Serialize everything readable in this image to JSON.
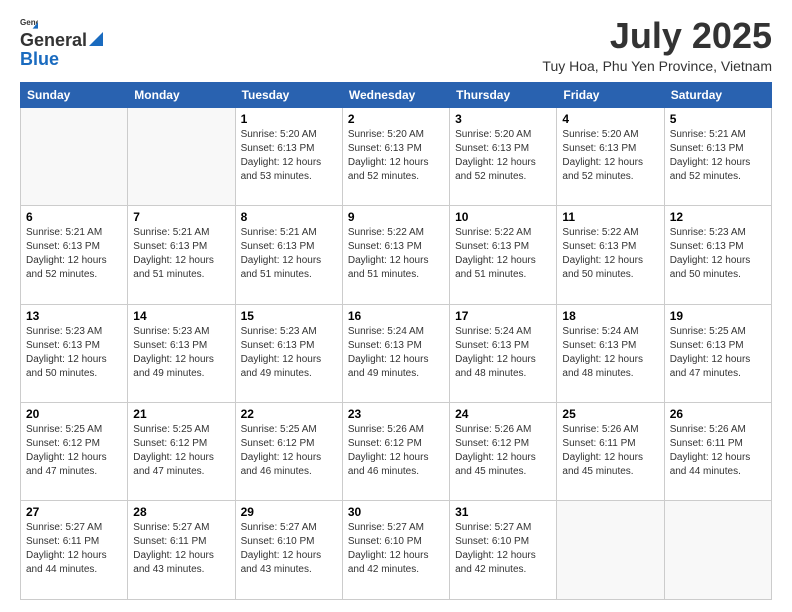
{
  "logo": {
    "line1": "General",
    "line2": "Blue"
  },
  "title": "July 2025",
  "subtitle": "Tuy Hoa, Phu Yen Province, Vietnam",
  "days_of_week": [
    "Sunday",
    "Monday",
    "Tuesday",
    "Wednesday",
    "Thursday",
    "Friday",
    "Saturday"
  ],
  "weeks": [
    [
      {
        "day": "",
        "sunrise": "",
        "sunset": "",
        "daylight": ""
      },
      {
        "day": "",
        "sunrise": "",
        "sunset": "",
        "daylight": ""
      },
      {
        "day": "1",
        "sunrise": "Sunrise: 5:20 AM",
        "sunset": "Sunset: 6:13 PM",
        "daylight": "Daylight: 12 hours and 53 minutes."
      },
      {
        "day": "2",
        "sunrise": "Sunrise: 5:20 AM",
        "sunset": "Sunset: 6:13 PM",
        "daylight": "Daylight: 12 hours and 52 minutes."
      },
      {
        "day": "3",
        "sunrise": "Sunrise: 5:20 AM",
        "sunset": "Sunset: 6:13 PM",
        "daylight": "Daylight: 12 hours and 52 minutes."
      },
      {
        "day": "4",
        "sunrise": "Sunrise: 5:20 AM",
        "sunset": "Sunset: 6:13 PM",
        "daylight": "Daylight: 12 hours and 52 minutes."
      },
      {
        "day": "5",
        "sunrise": "Sunrise: 5:21 AM",
        "sunset": "Sunset: 6:13 PM",
        "daylight": "Daylight: 12 hours and 52 minutes."
      }
    ],
    [
      {
        "day": "6",
        "sunrise": "Sunrise: 5:21 AM",
        "sunset": "Sunset: 6:13 PM",
        "daylight": "Daylight: 12 hours and 52 minutes."
      },
      {
        "day": "7",
        "sunrise": "Sunrise: 5:21 AM",
        "sunset": "Sunset: 6:13 PM",
        "daylight": "Daylight: 12 hours and 51 minutes."
      },
      {
        "day": "8",
        "sunrise": "Sunrise: 5:21 AM",
        "sunset": "Sunset: 6:13 PM",
        "daylight": "Daylight: 12 hours and 51 minutes."
      },
      {
        "day": "9",
        "sunrise": "Sunrise: 5:22 AM",
        "sunset": "Sunset: 6:13 PM",
        "daylight": "Daylight: 12 hours and 51 minutes."
      },
      {
        "day": "10",
        "sunrise": "Sunrise: 5:22 AM",
        "sunset": "Sunset: 6:13 PM",
        "daylight": "Daylight: 12 hours and 51 minutes."
      },
      {
        "day": "11",
        "sunrise": "Sunrise: 5:22 AM",
        "sunset": "Sunset: 6:13 PM",
        "daylight": "Daylight: 12 hours and 50 minutes."
      },
      {
        "day": "12",
        "sunrise": "Sunrise: 5:23 AM",
        "sunset": "Sunset: 6:13 PM",
        "daylight": "Daylight: 12 hours and 50 minutes."
      }
    ],
    [
      {
        "day": "13",
        "sunrise": "Sunrise: 5:23 AM",
        "sunset": "Sunset: 6:13 PM",
        "daylight": "Daylight: 12 hours and 50 minutes."
      },
      {
        "day": "14",
        "sunrise": "Sunrise: 5:23 AM",
        "sunset": "Sunset: 6:13 PM",
        "daylight": "Daylight: 12 hours and 49 minutes."
      },
      {
        "day": "15",
        "sunrise": "Sunrise: 5:23 AM",
        "sunset": "Sunset: 6:13 PM",
        "daylight": "Daylight: 12 hours and 49 minutes."
      },
      {
        "day": "16",
        "sunrise": "Sunrise: 5:24 AM",
        "sunset": "Sunset: 6:13 PM",
        "daylight": "Daylight: 12 hours and 49 minutes."
      },
      {
        "day": "17",
        "sunrise": "Sunrise: 5:24 AM",
        "sunset": "Sunset: 6:13 PM",
        "daylight": "Daylight: 12 hours and 48 minutes."
      },
      {
        "day": "18",
        "sunrise": "Sunrise: 5:24 AM",
        "sunset": "Sunset: 6:13 PM",
        "daylight": "Daylight: 12 hours and 48 minutes."
      },
      {
        "day": "19",
        "sunrise": "Sunrise: 5:25 AM",
        "sunset": "Sunset: 6:13 PM",
        "daylight": "Daylight: 12 hours and 47 minutes."
      }
    ],
    [
      {
        "day": "20",
        "sunrise": "Sunrise: 5:25 AM",
        "sunset": "Sunset: 6:12 PM",
        "daylight": "Daylight: 12 hours and 47 minutes."
      },
      {
        "day": "21",
        "sunrise": "Sunrise: 5:25 AM",
        "sunset": "Sunset: 6:12 PM",
        "daylight": "Daylight: 12 hours and 47 minutes."
      },
      {
        "day": "22",
        "sunrise": "Sunrise: 5:25 AM",
        "sunset": "Sunset: 6:12 PM",
        "daylight": "Daylight: 12 hours and 46 minutes."
      },
      {
        "day": "23",
        "sunrise": "Sunrise: 5:26 AM",
        "sunset": "Sunset: 6:12 PM",
        "daylight": "Daylight: 12 hours and 46 minutes."
      },
      {
        "day": "24",
        "sunrise": "Sunrise: 5:26 AM",
        "sunset": "Sunset: 6:12 PM",
        "daylight": "Daylight: 12 hours and 45 minutes."
      },
      {
        "day": "25",
        "sunrise": "Sunrise: 5:26 AM",
        "sunset": "Sunset: 6:11 PM",
        "daylight": "Daylight: 12 hours and 45 minutes."
      },
      {
        "day": "26",
        "sunrise": "Sunrise: 5:26 AM",
        "sunset": "Sunset: 6:11 PM",
        "daylight": "Daylight: 12 hours and 44 minutes."
      }
    ],
    [
      {
        "day": "27",
        "sunrise": "Sunrise: 5:27 AM",
        "sunset": "Sunset: 6:11 PM",
        "daylight": "Daylight: 12 hours and 44 minutes."
      },
      {
        "day": "28",
        "sunrise": "Sunrise: 5:27 AM",
        "sunset": "Sunset: 6:11 PM",
        "daylight": "Daylight: 12 hours and 43 minutes."
      },
      {
        "day": "29",
        "sunrise": "Sunrise: 5:27 AM",
        "sunset": "Sunset: 6:10 PM",
        "daylight": "Daylight: 12 hours and 43 minutes."
      },
      {
        "day": "30",
        "sunrise": "Sunrise: 5:27 AM",
        "sunset": "Sunset: 6:10 PM",
        "daylight": "Daylight: 12 hours and 42 minutes."
      },
      {
        "day": "31",
        "sunrise": "Sunrise: 5:27 AM",
        "sunset": "Sunset: 6:10 PM",
        "daylight": "Daylight: 12 hours and 42 minutes."
      },
      {
        "day": "",
        "sunrise": "",
        "sunset": "",
        "daylight": ""
      },
      {
        "day": "",
        "sunrise": "",
        "sunset": "",
        "daylight": ""
      }
    ]
  ]
}
